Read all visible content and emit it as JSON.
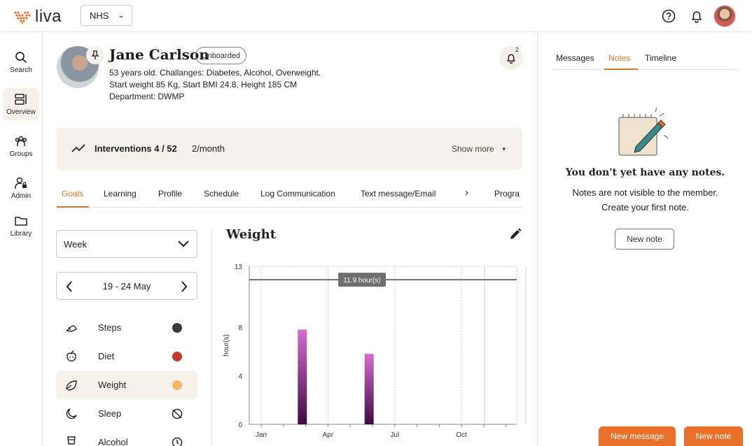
{
  "app": {
    "logo_text": "liva",
    "org": "NHS",
    "accent": "#d9772f",
    "brand": "#e8702a"
  },
  "nav": {
    "items": [
      {
        "label": "Search",
        "icon": "search-icon"
      },
      {
        "label": "Overview",
        "icon": "overview-icon",
        "active": true
      },
      {
        "label": "Groups",
        "icon": "groups-icon"
      },
      {
        "label": "Admin",
        "icon": "admin-icon"
      },
      {
        "label": "Library",
        "icon": "folder-icon"
      }
    ]
  },
  "member": {
    "name": "Jane Carlson",
    "status": "Onboarded",
    "line1": "53 years old. Challanges: Diabetes, Alcohol, Overweight.",
    "line2": "Start weight 85 Kg, Start BMI 24.8, Height 185 CM",
    "line3": "Department: DWMP",
    "notification_count": "2"
  },
  "interventions": {
    "title": "Interventions 4 / 52",
    "rate": "2/month",
    "show_more": "Show more"
  },
  "tabs": [
    "Goals",
    "Learning",
    "Profile",
    "Schedule",
    "Log Communication",
    "Text message/Email",
    "Progra"
  ],
  "filters": {
    "period": "Week",
    "date_range": "19 - 24 May"
  },
  "goals": [
    {
      "label": "Steps",
      "icon": "steps-icon",
      "color": "#3b3b3b"
    },
    {
      "label": "Diet",
      "icon": "apple-icon",
      "color": "#c0392b"
    },
    {
      "label": "Weight",
      "icon": "leaf-icon",
      "color": "#f6b66a",
      "active": true
    },
    {
      "label": "Sleep",
      "icon": "moon-icon",
      "status_icon": "blocked-icon"
    },
    {
      "label": "Alcohol",
      "icon": "glass-icon",
      "status_icon": "clock-icon"
    }
  ],
  "chart_title": "Weight",
  "chart_data": {
    "type": "bar",
    "title": "Weight",
    "ylabel": "hour(s)",
    "xlabel": "",
    "ylim": [
      0,
      13
    ],
    "y_ticks": [
      0,
      4,
      8,
      13
    ],
    "x_ticks": [
      "Jan",
      "Apr",
      "Jul",
      "Oct"
    ],
    "categories": [
      "Feb",
      "May"
    ],
    "values": [
      7.8,
      5.8
    ],
    "reference_line": {
      "value": 11.9,
      "label": "11.9 hour(s)"
    },
    "bar_colors": [
      "#d46fd0",
      "#3f0a44"
    ],
    "grid": true
  },
  "right_panel": {
    "tabs": [
      "Messages",
      "Notes",
      "Timeline"
    ],
    "active_tab": "Notes",
    "empty_title": "You don't yet have any notes.",
    "empty_line1": "Notes are not visible to the member.",
    "empty_line2": "Create your first note.",
    "new_note_button": "New note"
  },
  "footer": {
    "new_message": "New message",
    "new_note": "New note"
  }
}
